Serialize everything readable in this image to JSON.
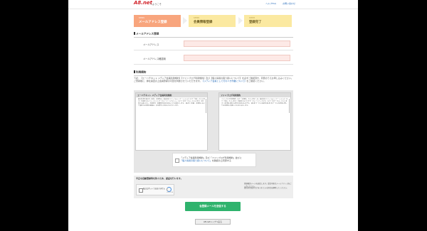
{
  "header": {
    "logo_text": "A8.net",
    "welcome": "へようこそ",
    "links": [
      "ヘルプFAQ",
      "お問い合わせ"
    ]
  },
  "steps": [
    {
      "num": "STEP1",
      "label": "メールアドレス登録",
      "active": true
    },
    {
      "num": "STEP2",
      "label": "会員情報登録",
      "active": false
    },
    {
      "num": "STEP3",
      "label": "登録完了",
      "active": false
    }
  ],
  "email_section": {
    "title": "メールアドレス登録",
    "email_label": "メールアドレス",
    "email_value": "",
    "confirm_label": "メールアドレス確認用",
    "confirm_value": ""
  },
  "terms": {
    "title": "利用規約",
    "intro_1": "下記、【エーハチネット メディア会員利用規約】【ファンブログ利用規約】及び【個人情報の取り扱いについて】を必ずご確認頂き、同意のうえお申し込みください。",
    "intro_2": "ご登録後に、弊社審査の上会員登録の可否を判断させていただきます。",
    "intro_link": "【メディア会員として行わべき作業について】",
    "intro_tail": "をご確認ください。",
    "col1_title": "エーハチネット メディア会員利用規約",
    "col1_body": "第1章 総則 第1条（目的） 本規約は、株式会社ファンコミュニケーションズ（以下「当社」といいます）が提供するアフィリエイトサービス「エーハチネット」（以下「本サービス」といいます）を利用する者に対し、利用条件・各種条件等を定めることを目的とします。 第2条（定義） 本規約において使用する用語の意義は、次の各号に定めるとおりとします。",
    "col2_title": "ファンブログ利用規約",
    "col2_body": "ファンブログ利用規約（以下「本規約」といいます）は、株式会社ファンコミュニケーションズ（以下「当社」といいます）が提供するブログサービス「ファンブログ」（以下「本サービス」といいます）の利用に関する条件を定めるものです。 第1章 サービスの提供 第1条 本サービスの利用に際しては本規約に同意したものとみなします。",
    "agree_text_1": "「メディア会員利用規約」及び「ファンブログ利用規約」並びに",
    "agree_link": "「個人情報の取り扱いについて」",
    "agree_text_2": "を確認の上同意する",
    "agree_checked": false
  },
  "robot": {
    "question": "不正な自動登録等を防ぐため、認証を行います。",
    "captcha_label": "私はロボットではありません",
    "captcha_brand": "reCAPTCHA",
    "note_1": "登録確認メールを送信します。受信可能なメールアドレスをご入力ください。",
    "note_2": "受信拒否設定などをされている場合は解除してください。"
  },
  "buttons": {
    "submit": "仮登録メールを送信する",
    "back": "A8.netトップへ戻る"
  }
}
